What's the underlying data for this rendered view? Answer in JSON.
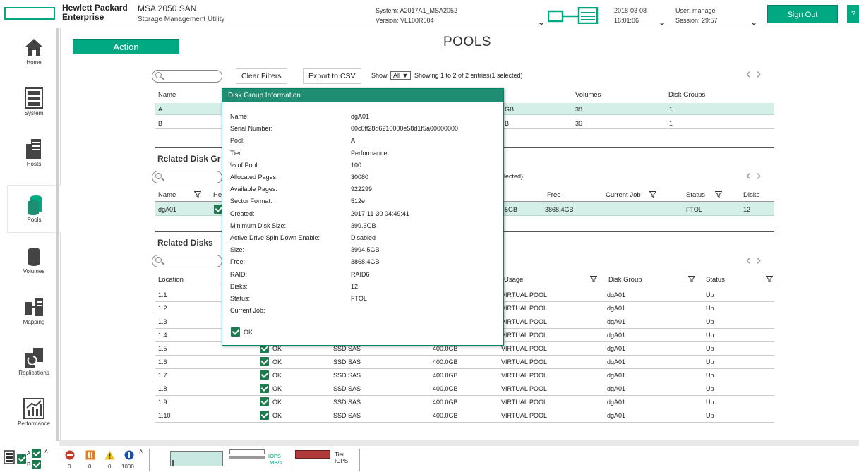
{
  "header": {
    "brand_line1": "Hewlett Packard",
    "brand_line2": "Enterprise",
    "product": "MSA 2050 SAN",
    "subtitle": "Storage Management Utility",
    "system": "System: A2017A1_MSA2052",
    "version": "Version: VL100R004",
    "date": "2018-03-08",
    "time": "16:01:06",
    "user": "User: manage",
    "session": "Session: 29:57",
    "signout": "Sign Out",
    "help": "?"
  },
  "sidebar": {
    "items": [
      {
        "label": "Home",
        "icon": "home-icon"
      },
      {
        "label": "System",
        "icon": "system-icon"
      },
      {
        "label": "Hosts",
        "icon": "hosts-icon"
      },
      {
        "label": "Pools",
        "icon": "pools-icon",
        "selected": true
      },
      {
        "label": "Volumes",
        "icon": "volumes-icon"
      },
      {
        "label": "Mapping",
        "icon": "mapping-icon"
      },
      {
        "label": "Replications",
        "icon": "replications-icon"
      },
      {
        "label": "Performance",
        "icon": "performance-icon"
      }
    ]
  },
  "main": {
    "action": "Action",
    "title": "POOLS",
    "clear_filters": "Clear Filters",
    "export_csv": "Export to CSV",
    "show_label": "Show",
    "show_value": "All ▼",
    "showing": "Showing 1 to 2 of 2 entries(1 selected)"
  },
  "pools_table": {
    "headers": {
      "name": "Name",
      "volumes": "Volumes",
      "disk_groups": "Disk Groups"
    },
    "rows": [
      {
        "name": "A",
        "size_tail": "GB",
        "volumes": "38",
        "disk_groups": "1",
        "selected": true
      },
      {
        "name": "B",
        "size_tail": "B",
        "volumes": "36",
        "disk_groups": "1"
      }
    ]
  },
  "disk_groups": {
    "section": "Related Disk Gr",
    "showing_tail": "lected)",
    "headers": {
      "name": "Name",
      "health": "He",
      "free": "Free",
      "current_job": "Current Job",
      "status": "Status",
      "disks": "Disks"
    },
    "row": {
      "name": "dgA01",
      "size_tail": "5GB",
      "free": "3868.4GB",
      "status": "FTOL",
      "disks": "12"
    }
  },
  "related_disks": {
    "section": "Related Disks",
    "headers": {
      "location": "Location",
      "usage": "Usage",
      "disk_group": "Disk Group",
      "status": "Status"
    },
    "rows": [
      {
        "location": "1.1",
        "health": "",
        "type": "",
        "size": "",
        "usage": "VIRTUAL POOL",
        "group": "dgA01",
        "status": "Up"
      },
      {
        "location": "1.2",
        "health": "",
        "type": "",
        "size": "",
        "usage": "VIRTUAL POOL",
        "group": "dgA01",
        "status": "Up"
      },
      {
        "location": "1.3",
        "health": "",
        "type": "",
        "size": "",
        "usage": "VIRTUAL POOL",
        "group": "dgA01",
        "status": "Up"
      },
      {
        "location": "1.4",
        "health": "",
        "type": "",
        "size": "",
        "usage": "VIRTUAL POOL",
        "group": "dgA01",
        "status": "Up"
      },
      {
        "location": "1.5",
        "health": "OK",
        "type": "SSD SAS",
        "size": "400.0GB",
        "usage": "VIRTUAL POOL",
        "group": "dgA01",
        "status": "Up"
      },
      {
        "location": "1.6",
        "health": "OK",
        "type": "SSD SAS",
        "size": "400.0GB",
        "usage": "VIRTUAL POOL",
        "group": "dgA01",
        "status": "Up"
      },
      {
        "location": "1.7",
        "health": "OK",
        "type": "SSD SAS",
        "size": "400.0GB",
        "usage": "VIRTUAL POOL",
        "group": "dgA01",
        "status": "Up"
      },
      {
        "location": "1.8",
        "health": "OK",
        "type": "SSD SAS",
        "size": "400.0GB",
        "usage": "VIRTUAL POOL",
        "group": "dgA01",
        "status": "Up"
      },
      {
        "location": "1.9",
        "health": "OK",
        "type": "SSD SAS",
        "size": "400.0GB",
        "usage": "VIRTUAL POOL",
        "group": "dgA01",
        "status": "Up"
      },
      {
        "location": "1.10",
        "health": "OK",
        "type": "SSD SAS",
        "size": "400.0GB",
        "usage": "VIRTUAL POOL",
        "group": "dgA01",
        "status": "Up"
      }
    ]
  },
  "popup": {
    "title": "Disk Group Information",
    "fields": [
      {
        "label": "Name:",
        "value": "dgA01"
      },
      {
        "label": "Serial Number:",
        "value": "00c0ff28d6210000e58d1f5a00000000"
      },
      {
        "label": "Pool:",
        "value": "A"
      },
      {
        "label": "Tier:",
        "value": "Performance"
      },
      {
        "label": "% of Pool:",
        "value": "100"
      },
      {
        "label": "Allocated Pages:",
        "value": "30080"
      },
      {
        "label": "Available Pages:",
        "value": "922299"
      },
      {
        "label": "Sector Format:",
        "value": "512e"
      },
      {
        "label": "Created:",
        "value": "2017-11-30 04:49:41"
      },
      {
        "label": "Minimum Disk Size:",
        "value": "399.6GB"
      },
      {
        "label": "Active Drive Spin Down Enable:",
        "value": "Disabled"
      },
      {
        "label": "Size:",
        "value": "3994.5GB"
      },
      {
        "label": "Free:",
        "value": "3868.4GB"
      },
      {
        "label": "RAID:",
        "value": "RAID6"
      },
      {
        "label": "Disks:",
        "value": "12"
      },
      {
        "label": "Status:",
        "value": "FTOL"
      },
      {
        "label": "Current Job:",
        "value": ""
      }
    ],
    "ok": "OK"
  },
  "footer": {
    "ctrl_a": "A",
    "ctrl_b": "B",
    "counts": [
      "0",
      "0",
      "0",
      "1000"
    ],
    "iops": "IOPS",
    "mbs": "MB/s",
    "tier": "Tier",
    "tier_iops": "IOPS"
  },
  "colors": {
    "accent": "#01a982",
    "ok_green": "#1f7a50",
    "selected_row": "#d3efe8",
    "tier_bar": "#b03a3a"
  }
}
